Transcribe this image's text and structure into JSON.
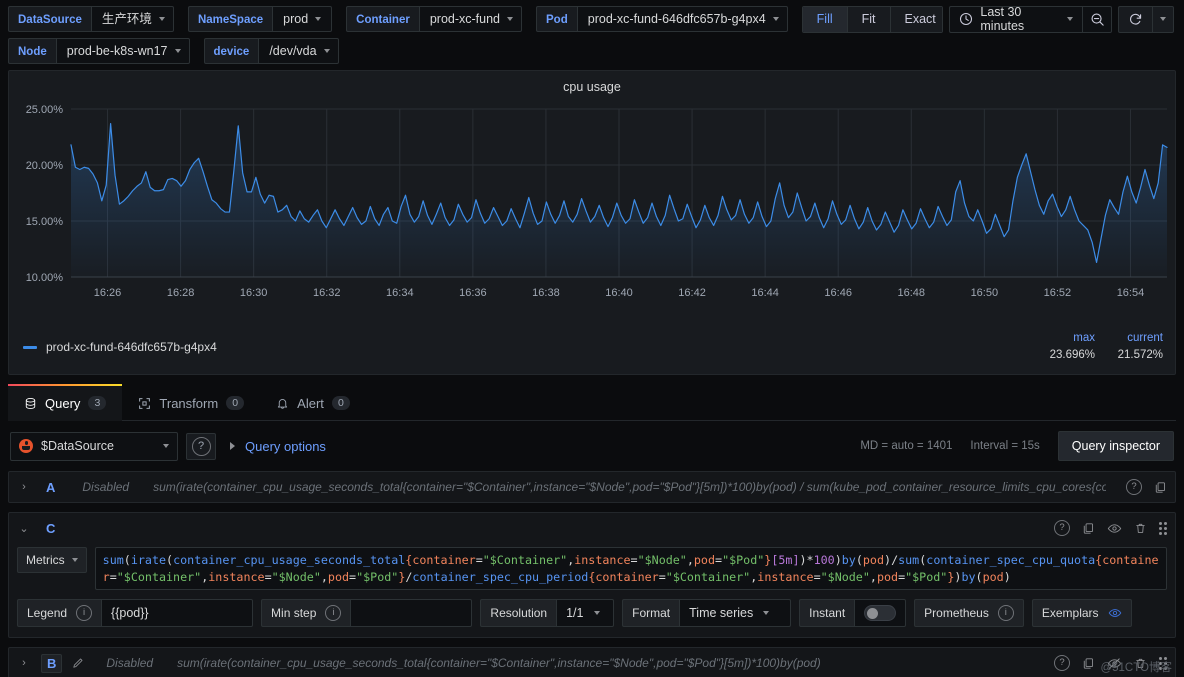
{
  "toolbar": {
    "variables": [
      {
        "label": "DataSource",
        "value": "生产环境"
      },
      {
        "label": "NameSpace",
        "value": "prod"
      },
      {
        "label": "Container",
        "value": "prod-xc-fund"
      },
      {
        "label": "Pod",
        "value": "prod-xc-fund-646dfc657b-g4px4"
      }
    ],
    "variables_row2": [
      {
        "label": "Node",
        "value": "prod-be-k8s-wn17"
      },
      {
        "label": "device",
        "value": "/dev/vda"
      }
    ],
    "fit_buttons": [
      {
        "label": "Fill",
        "active": true
      },
      {
        "label": "Fit",
        "active": false
      },
      {
        "label": "Exact",
        "active": false
      }
    ],
    "time_range": "Last 30 minutes",
    "icons": {
      "clock": "clock-icon",
      "zoom_out": "zoom-out-icon",
      "refresh": "refresh-icon",
      "refresh_caret": "chevron-down-icon"
    }
  },
  "panel": {
    "title": "cpu usage",
    "legend": {
      "series": "prod-xc-fund-646dfc657b-g4px4",
      "color": "#3c8ce7",
      "stat_headers": [
        "max",
        "current"
      ],
      "stat_values": [
        "23.696%",
        "21.572%"
      ]
    }
  },
  "chart_data": {
    "type": "line",
    "title": "cpu usage",
    "xlabel": "",
    "ylabel": "",
    "ylim": [
      10,
      25
    ],
    "ytick_labels": [
      "25.00%",
      "20.00%",
      "15.00%",
      "10.00%"
    ],
    "ytick_values": [
      25,
      20,
      15,
      10
    ],
    "xtick_labels": [
      "16:26",
      "16:28",
      "16:30",
      "16:32",
      "16:34",
      "16:36",
      "16:38",
      "16:40",
      "16:42",
      "16:44",
      "16:46",
      "16:48",
      "16:50",
      "16:52",
      "16:54"
    ],
    "grid": true,
    "legend_position": "bottom",
    "series": [
      {
        "name": "prod-xc-fund-646dfc657b-g4px4",
        "color": "#3c8ce7",
        "fill": true,
        "max": 23.696,
        "current": 21.572,
        "values": [
          21.8,
          19.8,
          19.6,
          19.8,
          19.7,
          19.2,
          18.4,
          16.8,
          18.2,
          23.7,
          19.1,
          16.5,
          16.8,
          17.2,
          17.7,
          18.1,
          18.4,
          19.4,
          18.0,
          17.7,
          17.7,
          17.8,
          18.7,
          18.8,
          18.6,
          18.1,
          18.6,
          19.6,
          20.2,
          20.6,
          19.4,
          18.1,
          16.9,
          16.6,
          16.1,
          15.8,
          15.8,
          19.5,
          23.5,
          19.3,
          17.6,
          17.6,
          18.9,
          17.4,
          16.6,
          17.3,
          17.2,
          15.8,
          16.0,
          16.4,
          15.4,
          15.0,
          15.9,
          15.2,
          14.9,
          15.5,
          16.0,
          15.0,
          14.4,
          15.2,
          16.0,
          15.2,
          14.6,
          15.4,
          16.2,
          15.3,
          14.7,
          15.0,
          16.3,
          15.2,
          14.6,
          15.6,
          16.2,
          15.0,
          14.8,
          16.3,
          17.3,
          15.6,
          14.9,
          15.4,
          16.8,
          15.5,
          14.7,
          15.6,
          16.6,
          15.3,
          14.6,
          15.1,
          16.5,
          15.6,
          14.9,
          15.3,
          16.9,
          15.7,
          14.8,
          15.2,
          16.2,
          15.4,
          14.6,
          15.0,
          16.1,
          15.2,
          14.4,
          15.7,
          17.1,
          15.7,
          14.7,
          15.0,
          16.7,
          15.6,
          14.8,
          15.5,
          16.8,
          15.4,
          14.9,
          15.6,
          17.0,
          15.9,
          14.9,
          15.4,
          16.4,
          15.3,
          14.5,
          15.3,
          16.6,
          15.5,
          14.8,
          15.2,
          16.9,
          15.8,
          14.8,
          15.3,
          16.6,
          15.4,
          14.6,
          15.5,
          17.3,
          16.1,
          15.0,
          15.2,
          16.5,
          15.4,
          14.4,
          15.1,
          16.4,
          15.3,
          14.6,
          15.5,
          17.2,
          16.0,
          15.1,
          15.5,
          16.9,
          15.6,
          14.8,
          15.3,
          16.7,
          15.4,
          14.5,
          15.0,
          17.0,
          18.4,
          16.4,
          15.3,
          15.8,
          17.5,
          16.2,
          15.0,
          15.4,
          16.6,
          15.3,
          14.4,
          15.2,
          16.8,
          15.6,
          14.7,
          15.1,
          16.4,
          15.2,
          14.3,
          14.9,
          16.2,
          15.0,
          14.2,
          14.7,
          15.8,
          14.9,
          14.0,
          14.6,
          16.0,
          15.1,
          14.3,
          14.8,
          16.1,
          15.2,
          14.4,
          14.9,
          16.3,
          15.4,
          14.6,
          15.1,
          17.6,
          18.6,
          16.6,
          15.4,
          15.0,
          16.0,
          15.0,
          13.9,
          14.3,
          15.6,
          14.6,
          13.6,
          14.2,
          16.8,
          18.9,
          20.0,
          21.0,
          19.4,
          17.8,
          16.4,
          15.6,
          16.8,
          17.4,
          16.3,
          15.4,
          16.0,
          17.2,
          16.0,
          15.0,
          14.6,
          14.2,
          13.1,
          11.3,
          13.4,
          15.5,
          16.9,
          16.2,
          15.6,
          17.6,
          19.0,
          17.6,
          16.6,
          18.0,
          19.6,
          18.2,
          17.0,
          18.4,
          21.8,
          21.572
        ]
      }
    ]
  },
  "tabs": [
    {
      "label": "Query",
      "count": "3",
      "icon": "database-icon",
      "active": true
    },
    {
      "label": "Transform",
      "count": "0",
      "icon": "transform-icon",
      "active": false
    },
    {
      "label": "Alert",
      "count": "0",
      "icon": "bell-icon",
      "active": false
    }
  ],
  "query_options": {
    "datasource": "$DataSource",
    "help_icon": "help-circle-icon",
    "toggle_label": "Query options",
    "md_info": "MD = auto = 1401",
    "interval_info": "Interval = 15s",
    "inspector_label": "Query inspector"
  },
  "queries": [
    {
      "letter": "A",
      "expanded": false,
      "disabled_label": "Disabled",
      "expr": "sum(irate(container_cpu_usage_seconds_total{container=\"$Container\",instance=\"$Node\",pod=\"$Pod\"}[5m])*100)by(pod) / sum(kube_pod_container_resource_limits_cpu_cores{container=\"$Container\",node=\"$Node\",pod=\"$Pod\"})by(pod)",
      "actions": [
        "help-circle-icon",
        "copy-icon"
      ]
    },
    {
      "letter": "C",
      "expanded": true,
      "editor_label": "Metrics",
      "expr_parts": [
        {
          "t": "sum",
          "c": "fn"
        },
        {
          "t": "(",
          "c": "op"
        },
        {
          "t": "irate",
          "c": "fn"
        },
        {
          "t": "(",
          "c": "op"
        },
        {
          "t": "container_cpu_usage_seconds_total",
          "c": "fn"
        },
        {
          "t": "{",
          "c": "lbl"
        },
        {
          "t": "container",
          "c": "lbl"
        },
        {
          "t": "=",
          "c": "op"
        },
        {
          "t": "\"$Container\"",
          "c": "str"
        },
        {
          "t": ",",
          "c": "op"
        },
        {
          "t": "instance",
          "c": "lbl"
        },
        {
          "t": "=",
          "c": "op"
        },
        {
          "t": "\"$Node\"",
          "c": "str"
        },
        {
          "t": ",",
          "c": "op"
        },
        {
          "t": "pod",
          "c": "lbl"
        },
        {
          "t": "=",
          "c": "op"
        },
        {
          "t": "\"$Pod\"",
          "c": "str"
        },
        {
          "t": "}",
          "c": "lbl"
        },
        {
          "t": "[5m]",
          "c": "num"
        },
        {
          "t": ")",
          "c": "op"
        },
        {
          "t": "*",
          "c": "op"
        },
        {
          "t": "100",
          "c": "num"
        },
        {
          "t": ")",
          "c": "op"
        },
        {
          "t": "by",
          "c": "fn"
        },
        {
          "t": "(",
          "c": "op"
        },
        {
          "t": "pod",
          "c": "lbl"
        },
        {
          "t": ")",
          "c": "op"
        },
        {
          "t": "/",
          "c": "op"
        },
        {
          "t": "sum",
          "c": "fn"
        },
        {
          "t": "(",
          "c": "op"
        },
        {
          "t": "container_spec_cpu_quota",
          "c": "fn"
        },
        {
          "t": "{",
          "c": "lbl"
        },
        {
          "t": "container",
          "c": "lbl"
        },
        {
          "t": "=",
          "c": "op"
        },
        {
          "t": "\"$Container\"",
          "c": "str"
        },
        {
          "t": ",",
          "c": "op"
        },
        {
          "t": "instance",
          "c": "lbl"
        },
        {
          "t": "=",
          "c": "op"
        },
        {
          "t": "\"$Node\"",
          "c": "str"
        },
        {
          "t": ",",
          "c": "op"
        },
        {
          "t": "pod",
          "c": "lbl"
        },
        {
          "t": "=",
          "c": "op"
        },
        {
          "t": "\"$Pod\"",
          "c": "str"
        },
        {
          "t": "}",
          "c": "lbl"
        },
        {
          "t": "/",
          "c": "op"
        },
        {
          "t": "container_spec_cpu_period",
          "c": "fn"
        },
        {
          "t": "{",
          "c": "lbl"
        },
        {
          "t": "container",
          "c": "lbl"
        },
        {
          "t": "=",
          "c": "op"
        },
        {
          "t": "\"$Container\"",
          "c": "str"
        },
        {
          "t": ",",
          "c": "op"
        },
        {
          "t": "instance",
          "c": "lbl"
        },
        {
          "t": "=",
          "c": "op"
        },
        {
          "t": "\"$Node\"",
          "c": "str"
        },
        {
          "t": ",",
          "c": "op"
        },
        {
          "t": "pod",
          "c": "lbl"
        },
        {
          "t": "=",
          "c": "op"
        },
        {
          "t": "\"$Pod\"",
          "c": "str"
        },
        {
          "t": "}",
          "c": "lbl"
        },
        {
          "t": ")",
          "c": "op"
        },
        {
          "t": "by",
          "c": "fn"
        },
        {
          "t": "(",
          "c": "op"
        },
        {
          "t": "pod",
          "c": "lbl"
        },
        {
          "t": ")",
          "c": "op"
        }
      ],
      "options": {
        "legend_label": "Legend",
        "legend_value": "{{pod}}",
        "min_step_label": "Min step",
        "min_step_value": "",
        "resolution_label": "Resolution",
        "resolution_value": "1/1",
        "format_label": "Format",
        "format_value": "Time series",
        "instant_label": "Instant",
        "instant_on": false,
        "prometheus_label": "Prometheus",
        "exemplars_label": "Exemplars"
      }
    },
    {
      "letter": "B",
      "expanded": false,
      "disabled_label": "Disabled",
      "expr": "sum(irate(container_cpu_usage_seconds_total{container=\"$Container\",instance=\"$Node\",pod=\"$Pod\"}[5m])*100)by(pod)",
      "has_pencil": true
    }
  ],
  "watermark": "@51CTO博客"
}
